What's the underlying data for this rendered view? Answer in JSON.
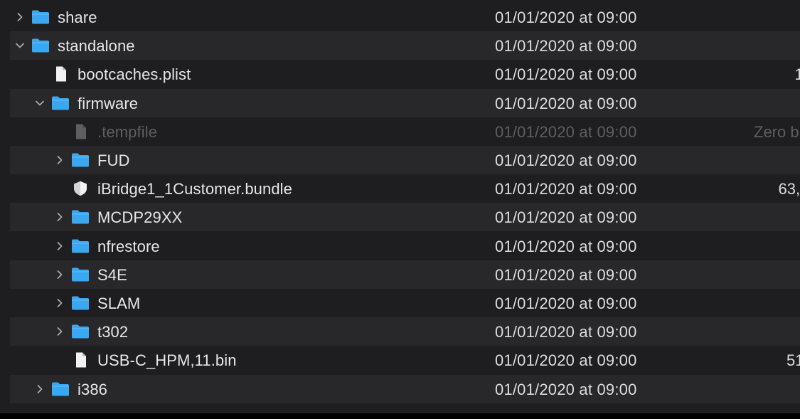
{
  "colors": {
    "background": "#1e1e20",
    "row_stripe": "#28282b",
    "folder_blue": "#3aa8f0",
    "text": "#e6e6e8",
    "dimmed_text": "#5e5e62"
  },
  "rows": [
    {
      "name": "share",
      "date": "01/01/2020 at 09:00",
      "size": "",
      "kind": "folder",
      "depth": 0,
      "disclosure": "collapsed",
      "dimmed": false
    },
    {
      "name": "standalone",
      "date": "01/01/2020 at 09:00",
      "size": "",
      "kind": "folder",
      "depth": 0,
      "disclosure": "expanded",
      "dimmed": false
    },
    {
      "name": "bootcaches.plist",
      "date": "01/01/2020 at 09:00",
      "size": "1",
      "kind": "document",
      "depth": 1,
      "disclosure": "none",
      "dimmed": false
    },
    {
      "name": "firmware",
      "date": "01/01/2020 at 09:00",
      "size": "",
      "kind": "folder",
      "depth": 1,
      "disclosure": "expanded",
      "dimmed": false
    },
    {
      "name": ".tempfile",
      "date": "01/01/2020 at 09:00",
      "size": "Zero b",
      "kind": "document",
      "depth": 2,
      "disclosure": "none",
      "dimmed": true
    },
    {
      "name": "FUD",
      "date": "01/01/2020 at 09:00",
      "size": "",
      "kind": "folder",
      "depth": 2,
      "disclosure": "collapsed",
      "dimmed": false
    },
    {
      "name": "iBridge1_1Customer.bundle",
      "date": "01/01/2020 at 09:00",
      "size": "63,",
      "kind": "bundle",
      "depth": 2,
      "disclosure": "none",
      "dimmed": false
    },
    {
      "name": "MCDP29XX",
      "date": "01/01/2020 at 09:00",
      "size": "",
      "kind": "folder",
      "depth": 2,
      "disclosure": "collapsed",
      "dimmed": false
    },
    {
      "name": "nfrestore",
      "date": "01/01/2020 at 09:00",
      "size": "",
      "kind": "folder",
      "depth": 2,
      "disclosure": "collapsed",
      "dimmed": false
    },
    {
      "name": "S4E",
      "date": "01/01/2020 at 09:00",
      "size": "",
      "kind": "folder",
      "depth": 2,
      "disclosure": "collapsed",
      "dimmed": false
    },
    {
      "name": "SLAM",
      "date": "01/01/2020 at 09:00",
      "size": "",
      "kind": "folder",
      "depth": 2,
      "disclosure": "collapsed",
      "dimmed": false
    },
    {
      "name": "t302",
      "date": "01/01/2020 at 09:00",
      "size": "",
      "kind": "folder",
      "depth": 2,
      "disclosure": "collapsed",
      "dimmed": false
    },
    {
      "name": "USB-C_HPM,11.bin",
      "date": "01/01/2020 at 09:00",
      "size": "51",
      "kind": "document",
      "depth": 2,
      "disclosure": "none",
      "dimmed": false
    },
    {
      "name": "i386",
      "date": "01/01/2020 at 09:00",
      "size": "",
      "kind": "folder",
      "depth": 1,
      "disclosure": "collapsed",
      "dimmed": false
    }
  ]
}
